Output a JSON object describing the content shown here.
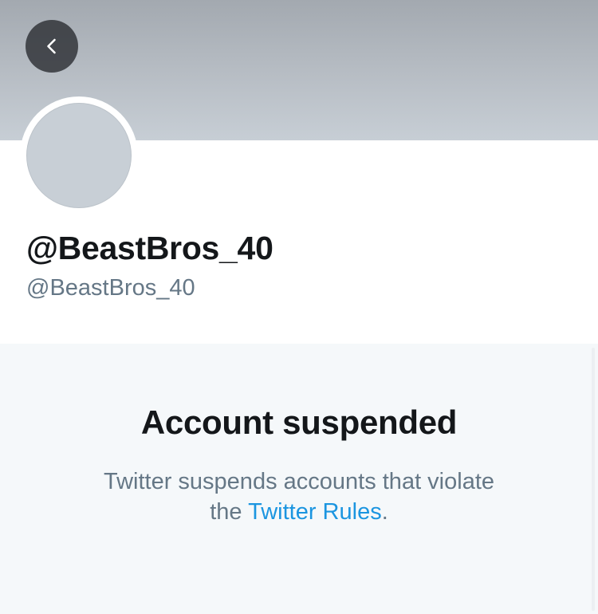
{
  "header": {
    "back_icon": "chevron-left-icon",
    "banner_color": "#b6bcc3"
  },
  "profile": {
    "display_name": "@BeastBros_40",
    "handle": "@BeastBros_40",
    "avatar_color": "#c8cfd6"
  },
  "notice": {
    "title": "Account suspended",
    "body_line1": "Twitter suspends accounts that violate",
    "body_line2_prefix": "the ",
    "rules_link": "Twitter Rules",
    "body_suffix": ".",
    "link_color": "#1b95e0"
  }
}
